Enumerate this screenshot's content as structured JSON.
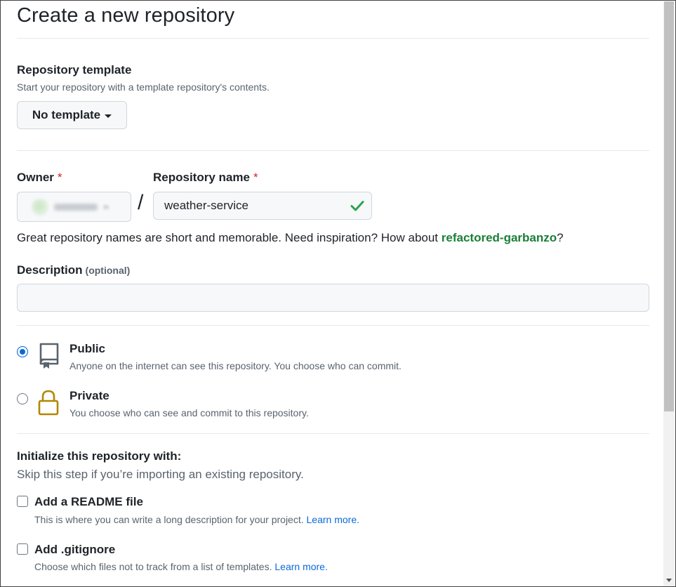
{
  "page": {
    "title": "Create a new repository"
  },
  "template": {
    "label": "Repository template",
    "description": "Start your repository with a template repository's contents.",
    "button_label": "No template"
  },
  "owner": {
    "label": "Owner",
    "required_marker": "*"
  },
  "repo_name": {
    "label": "Repository name",
    "required_marker": "*",
    "value": "weather-service",
    "separator": "/",
    "hint_prefix": "Great repository names are short and memorable. Need inspiration? How about ",
    "suggestion": "refactored-garbanzo",
    "hint_suffix": "?"
  },
  "description": {
    "label": "Description",
    "optional_label": "(optional)",
    "value": ""
  },
  "visibility": {
    "options": [
      {
        "title": "Public",
        "description": "Anyone on the internet can see this repository. You choose who can commit.",
        "icon": "repo-icon",
        "selected": true
      },
      {
        "title": "Private",
        "description": "You choose who can see and commit to this repository.",
        "icon": "lock-icon",
        "selected": false
      }
    ]
  },
  "initialize": {
    "title": "Initialize this repository with:",
    "description": "Skip this step if you’re importing an existing repository.",
    "options": [
      {
        "title": "Add a README file",
        "description": "This is where you can write a long description for your project.",
        "link": "Learn more.",
        "checked": false
      },
      {
        "title": "Add .gitignore",
        "description": "Choose which files not to track from a list of templates.",
        "link": "Learn more.",
        "checked": false
      }
    ]
  },
  "colors": {
    "accent_blue": "#0969da",
    "success_green": "#1a7f37",
    "required_red": "#d1242f",
    "lock_gold": "#b08800"
  }
}
